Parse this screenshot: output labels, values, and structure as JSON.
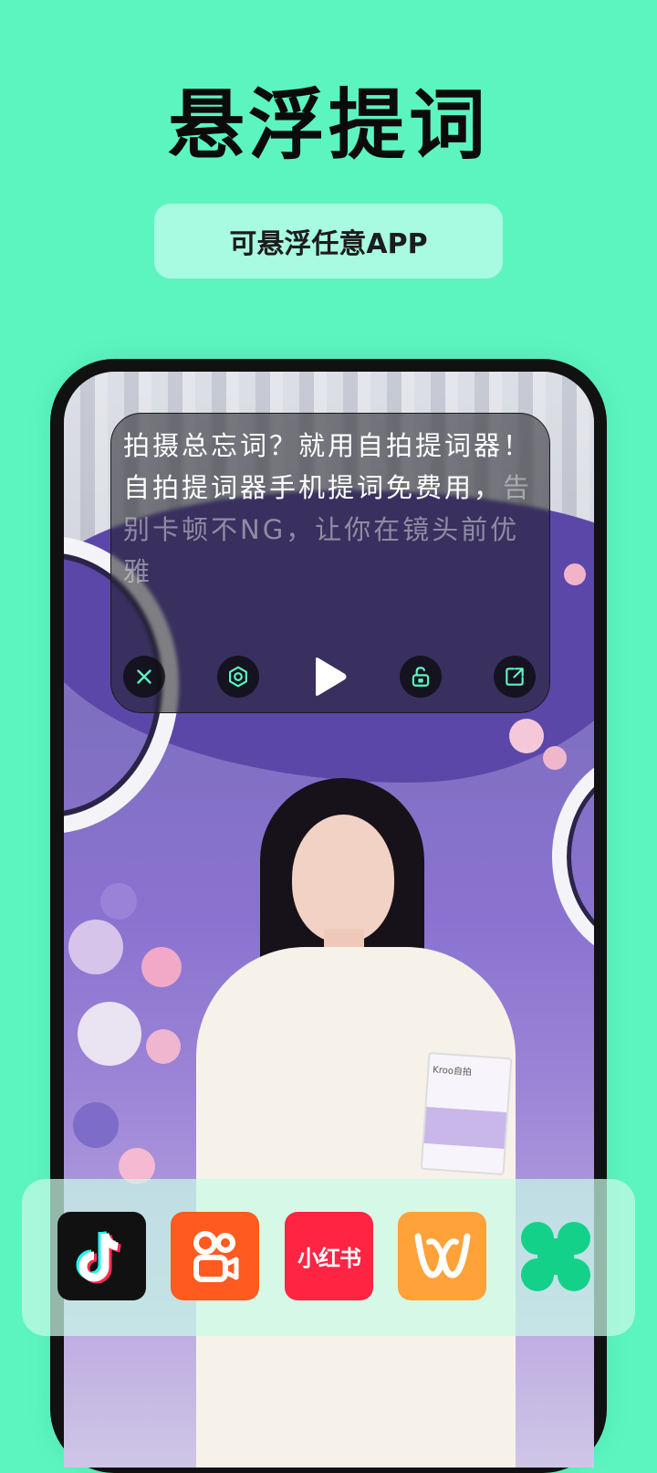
{
  "header": {
    "title": "悬浮提词",
    "subtitle": "可悬浮任意APP"
  },
  "prompter": {
    "text_active": "拍摄总忘词？就用自拍提词器！自拍提词器手机提词免费用，",
    "text_upcoming": "告别卡顿不NG，让你在镜头前优雅",
    "controls": [
      "close-icon",
      "settings-icon",
      "play-icon",
      "lock-icon",
      "expand-icon"
    ]
  },
  "product_box": {
    "label": "Kroo自拍"
  },
  "dock": {
    "apps": [
      {
        "name": "douyin-app-icon",
        "color": "#111111"
      },
      {
        "name": "kuaishou-app-icon",
        "color": "#ff5a1f"
      },
      {
        "name": "xiaohongshu-app-icon",
        "label": "小红书",
        "color": "#ff2442"
      },
      {
        "name": "app-w-icon",
        "color": "#ffa23a"
      },
      {
        "name": "clover-app-icon",
        "color": "#14d18a"
      }
    ]
  },
  "colors": {
    "background": "#5cf5c0",
    "pill": "#a8fae0",
    "accent": "#5cf5c0"
  }
}
